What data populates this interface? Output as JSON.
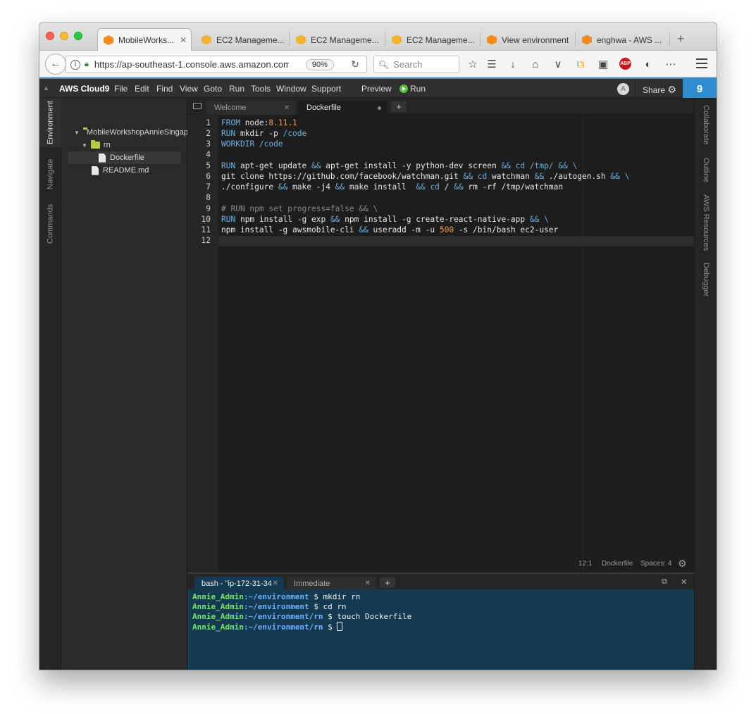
{
  "browser": {
    "tabs": [
      {
        "label": "MobileWorks...",
        "active": true,
        "close": "✕"
      },
      {
        "label": "EC2 Manageme..."
      },
      {
        "label": "EC2 Manageme..."
      },
      {
        "label": "EC2 Manageme..."
      },
      {
        "label": "View environment"
      },
      {
        "label": "enghwa - AWS ..."
      }
    ],
    "new_tab": "+",
    "url": "https://ap-southeast-1.console.aws.amazon.com",
    "zoom": "90%",
    "search_placeholder": "Search"
  },
  "menubar": {
    "brand": "AWS Cloud9",
    "items": [
      "File",
      "Edit",
      "Find",
      "View",
      "Goto",
      "Run",
      "Tools",
      "Window",
      "Support"
    ],
    "preview": "Preview",
    "run": "Run",
    "avatar": "A",
    "share": "Share",
    "cloud9_logo": "9"
  },
  "left_panel_tabs": [
    "Environment",
    "Navigate",
    "Commands"
  ],
  "right_panel_tabs": [
    "Collaborate",
    "Outline",
    "AWS Resources",
    "Debugger"
  ],
  "file_tree": {
    "root": "MobileWorkshopAnnieSingap",
    "folder": "rn",
    "child_file": "Dockerfile",
    "file": "README.md"
  },
  "editor_tabs": [
    {
      "label": "Welcome",
      "close": "✕"
    },
    {
      "label": "Dockerfile",
      "active": true
    }
  ],
  "editor_plus": "+",
  "code": {
    "line_numbers": [
      "1",
      "2",
      "3",
      "4",
      "5",
      "6",
      "7",
      "8",
      "9",
      "10",
      "11",
      "12"
    ],
    "lines": [
      "FROM node:8.11.1",
      "RUN mkdir -p /code",
      "WORKDIR /code",
      "",
      "RUN apt-get update && apt-get install -y python-dev screen && cd /tmp/ && \\",
      "git clone https://github.com/facebook/watchman.git && cd watchman && ./autogen.sh && \\",
      "./configure && make -j4 && make install  && cd / && rm -rf /tmp/watchman",
      "",
      "# RUN npm set progress=false && \\",
      "RUN npm install -g exp && npm install -g create-react-native-app && \\",
      "npm install -g awsmobile-cli && useradd -m -u 500 -s /bin/bash ec2-user",
      ""
    ]
  },
  "status": {
    "position": "12:1",
    "mode": "Dockerfile",
    "spaces": "Spaces: 4"
  },
  "terminal": {
    "tabs": [
      {
        "label": "bash - \"ip-172-31-34",
        "active": true,
        "close": "✕"
      },
      {
        "label": "Immediate",
        "close": "✕"
      }
    ],
    "plus": "+",
    "lines": [
      {
        "user": "Annie_Admin",
        "path": ":~/environment",
        "cmd": " $ mkdir rn"
      },
      {
        "user": "Annie_Admin",
        "path": ":~/environment",
        "cmd": " $ cd rn"
      },
      {
        "user": "Annie_Admin",
        "path": ":~/environment/rn",
        "cmd": " $ touch Dockerfile"
      },
      {
        "user": "Annie_Admin",
        "path": ":~/environment/rn",
        "cmd": " $ "
      }
    ]
  },
  "colors": {
    "accent": "#2f8ccf",
    "terminal_bg": "#143a52",
    "keyword": "#6ab0de",
    "number": "#f0a149",
    "terminal_user": "#78e36c",
    "terminal_path": "#6fb1ff"
  }
}
